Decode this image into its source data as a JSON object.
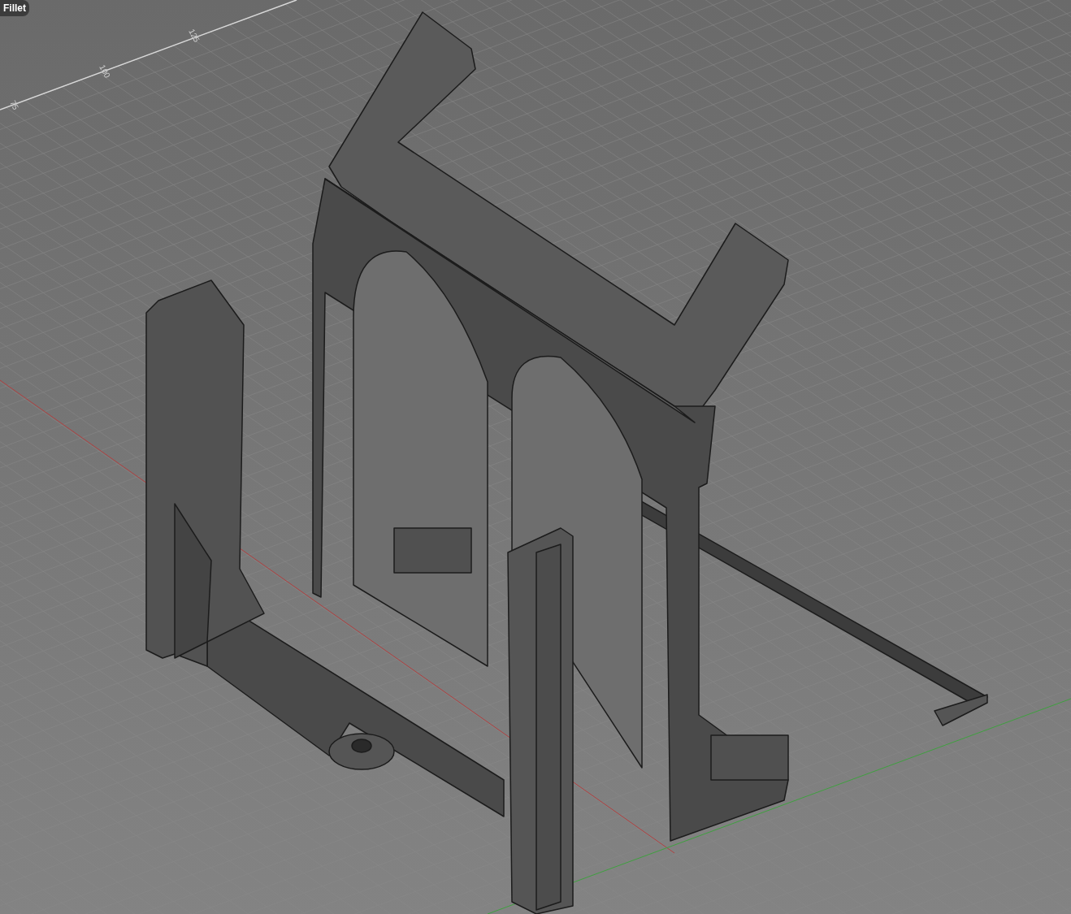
{
  "command_tooltip": {
    "text": "Fillet"
  },
  "grid_labels": [
    {
      "text": "125"
    },
    {
      "text": "100"
    },
    {
      "text": "75"
    }
  ]
}
